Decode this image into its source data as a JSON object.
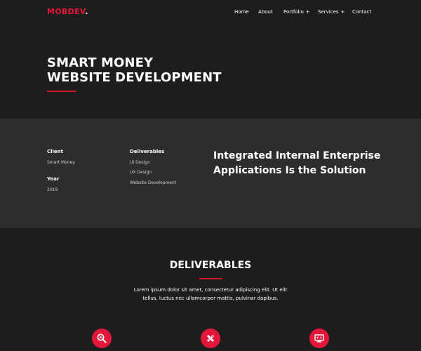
{
  "header": {
    "logo_text": "MOBDEV",
    "logo_dot": ".",
    "nav": [
      {
        "label": "Home",
        "has_submenu": false
      },
      {
        "label": "About",
        "has_submenu": false
      },
      {
        "label": "Portfolio",
        "has_submenu": true,
        "submenu_marker": "+"
      },
      {
        "label": "Services",
        "has_submenu": true,
        "submenu_marker": "+"
      },
      {
        "label": "Contact",
        "has_submenu": false
      }
    ]
  },
  "hero": {
    "title_line1": "SMART MONEY",
    "title_line2": "WEBSITE DEVELOPMENT"
  },
  "project": {
    "client_heading": "Client",
    "client_value": "Smart Money",
    "year_heading": "Year",
    "year_value": "2019",
    "deliverables_heading": "Deliverables",
    "deliverables": [
      "UI Design",
      "UX Design",
      "Website Development"
    ],
    "tagline_line1": "Integrated Internal Enterprise",
    "tagline_line2": "Applications Is the Solution"
  },
  "deliverables_section": {
    "title": "DELIVERABLES",
    "desc_line1": "Lorem ipsum dolor sit amet, consectetur adipiscing elit. Ut elit",
    "desc_line2": "tellus, luctus nec ullamcorper mattis, pulvinar dapibus.",
    "icons": [
      "search-analytics-icon",
      "design-tools-icon",
      "monitor-code-icon"
    ]
  },
  "colors": {
    "accent": "#e3173a",
    "background": "#1d1d1d",
    "band": "#2d2d2d"
  }
}
